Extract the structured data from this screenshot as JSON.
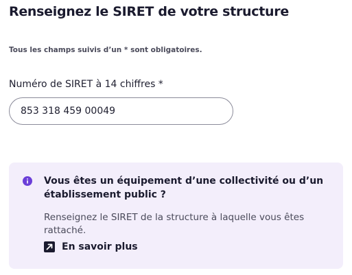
{
  "header": {
    "title": "Renseignez le SIRET de votre structure",
    "required_note": "Tous les champs suivis d’un * sont obligatoires."
  },
  "form": {
    "siret_label": "Numéro de SIRET à 14 chiffres *",
    "siret_value": "853 318 459 00049"
  },
  "callout": {
    "icon": "info-icon",
    "title": "Vous êtes un équipement d’une collectivité ou d’un établissement public ?",
    "text": "Renseignez le SIRET de la structure à laquelle vous êtes rattaché.",
    "link_label": "En savoir plus",
    "link_icon": "external-link-icon",
    "background_color": "#f3eefb",
    "accent_color": "#6b3fd8"
  }
}
